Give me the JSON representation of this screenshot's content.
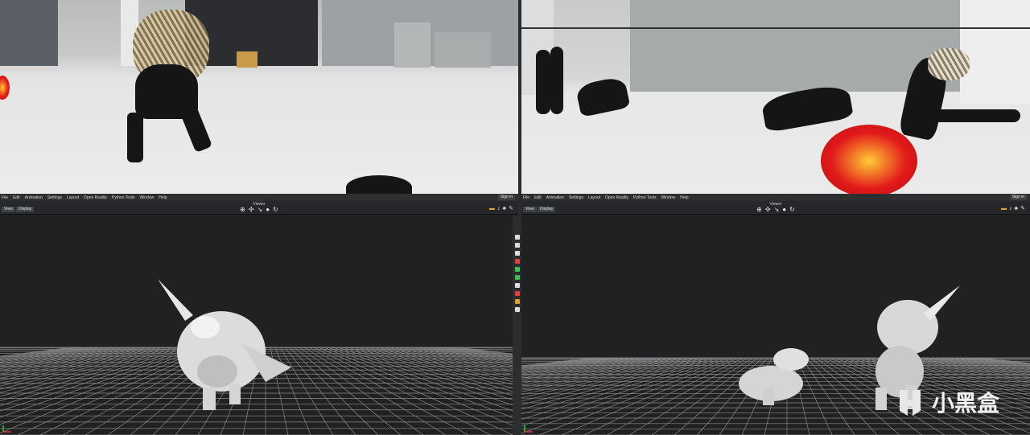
{
  "app": {
    "menu": [
      "File",
      "Edit",
      "Animation",
      "Settings",
      "Layout",
      "Open Reality",
      "Python Tools",
      "Window",
      "Help"
    ],
    "sign_in": "Sign in",
    "viewer_title": "Viewer",
    "view_btn": "View",
    "display_btn": "Display",
    "tool_icons": [
      "move-icon",
      "translate-icon",
      "rotate-icon",
      "scale-icon",
      "orbit-icon"
    ]
  },
  "watermark": {
    "text": "小黑盒"
  },
  "colors": {
    "lion_red": "#e21a1a",
    "grid_line": "#8a8a8a",
    "viewport_bg": "#202123"
  }
}
